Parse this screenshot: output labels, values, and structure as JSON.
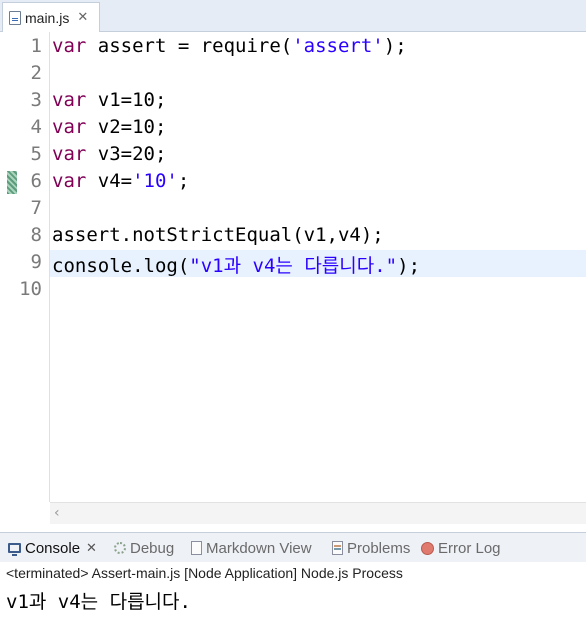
{
  "editor_tab": {
    "file_name": "main.js",
    "close_symbol": "✕",
    "icon": "js-file-icon"
  },
  "line_numbers": [
    "1",
    "2",
    "3",
    "4",
    "5",
    "6",
    "7",
    "8",
    "9",
    "10"
  ],
  "code": {
    "line1": {
      "kw": "var",
      "a": " assert = require(",
      "s": "'assert'",
      "b": ");"
    },
    "line3": {
      "kw": "var",
      "a": " v1=10;"
    },
    "line4": {
      "kw": "var",
      "a": " v2=10;"
    },
    "line5": {
      "kw": "var",
      "a": " v3=20;"
    },
    "line6": {
      "kw": "var",
      "a": " v4=",
      "s": "'10'",
      "b": ";"
    },
    "line8": {
      "a": "assert.notStrictEqual(v1,v4);"
    },
    "line9": {
      "a": "console.log(",
      "s": "\"v1과 v4는 다릅니다.\"",
      "b": ");"
    }
  },
  "scroll_left_arrow": "‹",
  "console_tabs": [
    {
      "label": "Console",
      "icon": "console-icon",
      "close_symbol": "✕"
    },
    {
      "label": "Debug",
      "icon": "debug-icon"
    },
    {
      "label": "Markdown View",
      "icon": "markdown-view-icon"
    },
    {
      "label": "Problems",
      "icon": "problems-icon"
    },
    {
      "label": "Error Log",
      "icon": "error-log-icon"
    }
  ],
  "console": {
    "status": "<terminated> Assert-main.js [Node Application] Node.js Process",
    "output": "v1과 v4는 다릅니다."
  },
  "colors": {
    "keyword": "#7f0055",
    "string": "#2a00ff",
    "current_line": "#e8f2fe"
  }
}
